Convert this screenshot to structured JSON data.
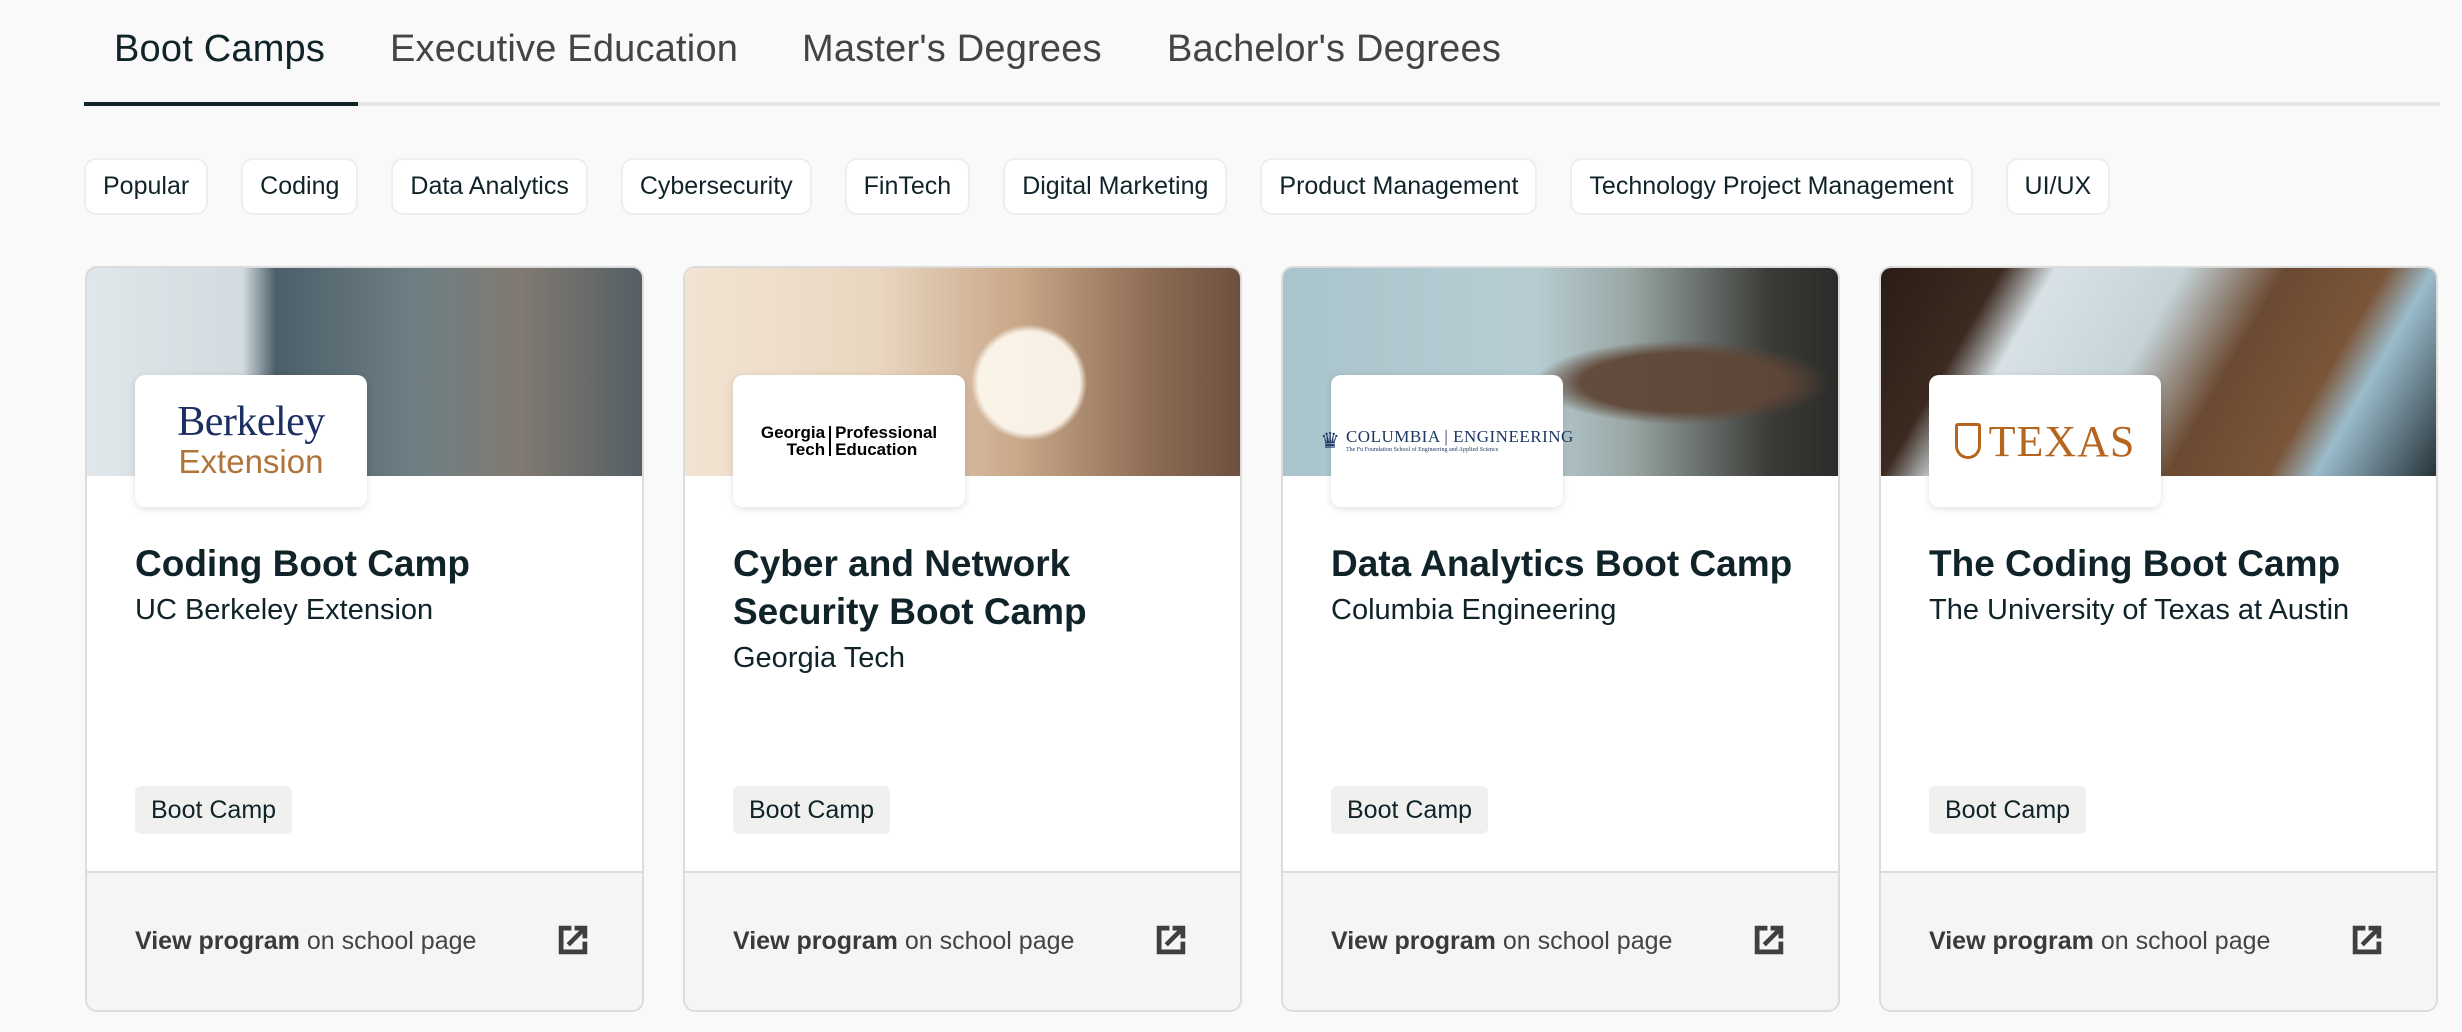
{
  "tabs": [
    {
      "label": "Boot Camps",
      "active": true
    },
    {
      "label": "Executive Education",
      "active": false
    },
    {
      "label": "Master's Degrees",
      "active": false
    },
    {
      "label": "Bachelor's Degrees",
      "active": false
    }
  ],
  "chips": [
    "Popular",
    "Coding",
    "Data Analytics",
    "Cybersecurity",
    "FinTech",
    "Digital Marketing",
    "Product Management",
    "Technology Project Management",
    "UI/UX"
  ],
  "colors": {
    "accent": "#0f2329",
    "footer_bg": "#f5f5f5",
    "badge_bg": "#f0f0ef",
    "berkeley_blue": "#1c2f63",
    "berkeley_gold": "#b0743a",
    "texas_orange": "#b5651d",
    "columbia_blue": "#1d3764"
  },
  "cards": [
    {
      "title": "Coding Boot Camp",
      "school": "UC Berkeley Extension",
      "logo": {
        "line1": "Berkeley",
        "line2": "Extension"
      },
      "badge": "Boot Camp",
      "footer_bold": "View program",
      "footer_rest": " on school page",
      "icon": "external-link-icon"
    },
    {
      "title": "Cyber and Network Security Boot Camp",
      "school": "Georgia Tech",
      "logo": {
        "left1": "Georgia",
        "left2": "Tech",
        "right1": "Professional",
        "right2": "Education"
      },
      "badge": "Boot Camp",
      "footer_bold": "View program",
      "footer_rest": " on school page",
      "icon": "external-link-icon"
    },
    {
      "title": "Data Analytics Boot Camp",
      "school": "Columbia Engineering",
      "logo": {
        "line1": "COLUMBIA | ENGINEERING",
        "line2": "The Fu Foundation School of Engineering and Applied Science"
      },
      "badge": "Boot Camp",
      "footer_bold": "View program",
      "footer_rest": " on school page",
      "icon": "external-link-icon"
    },
    {
      "title": "The Coding Boot Camp",
      "school": "The University of Texas at Austin",
      "logo": {
        "line1": "TEXAS"
      },
      "badge": "Boot Camp",
      "footer_bold": "View program",
      "footer_rest": " on school page",
      "icon": "external-link-icon"
    }
  ]
}
